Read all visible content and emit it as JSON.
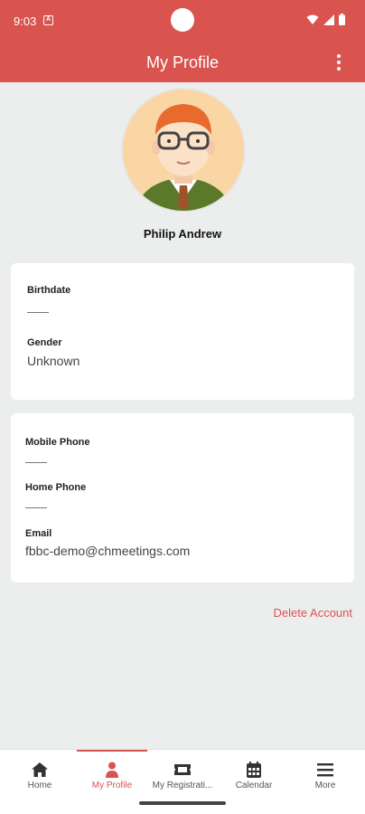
{
  "status_bar": {
    "time": "9:03",
    "notification_glyph": "A"
  },
  "app_bar": {
    "title": "My Profile"
  },
  "profile": {
    "name": "Philip Andrew"
  },
  "personal_card": {
    "birthdate_label": "Birthdate",
    "gender_label": "Gender",
    "gender_value": "Unknown"
  },
  "contact_card": {
    "mobile_phone_label": "Mobile Phone",
    "home_phone_label": "Home Phone",
    "email_label": "Email",
    "email_value": "fbbc-demo@chmeetings.com"
  },
  "actions": {
    "delete_account": "Delete Account"
  },
  "bottom_nav": {
    "items": [
      {
        "label": "Home",
        "icon": "home-icon"
      },
      {
        "label": "My Profile",
        "icon": "person-icon"
      },
      {
        "label": "My Registrati...",
        "icon": "ticket-icon"
      },
      {
        "label": "Calendar",
        "icon": "calendar-icon"
      },
      {
        "label": "More",
        "icon": "menu-icon"
      }
    ],
    "active_index": 1
  },
  "colors": {
    "primary": "#d9534f",
    "background": "#eceeee",
    "card": "#ffffff"
  }
}
